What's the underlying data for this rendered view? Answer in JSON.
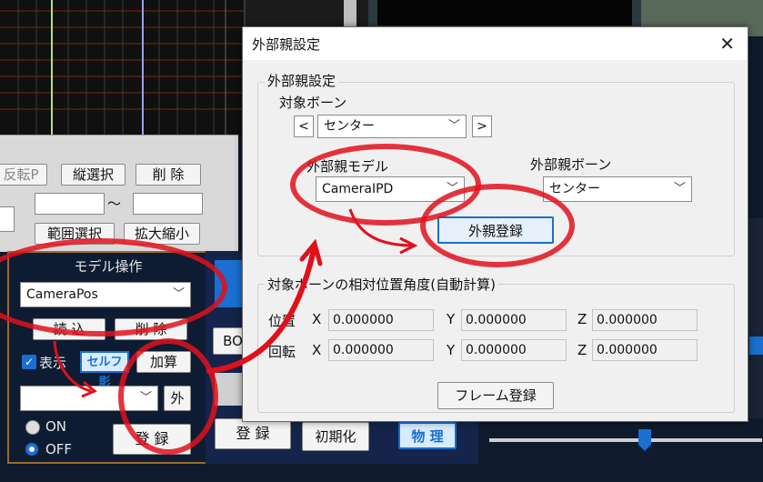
{
  "background": {
    "gray_panel": {
      "flip_label": "反転P",
      "vertical_select": "縦選択",
      "delete": "削 除",
      "tilde": "〜",
      "range_select": "範囲選択",
      "scale": "拡大縮小"
    },
    "model_panel": {
      "title": "モデル操作",
      "model_select": "CameraPos",
      "load": "読 込",
      "delete": "削 除",
      "display_label": "表示",
      "self_shadow": "セルフ影",
      "add_calc": "加算",
      "outer_button": "外",
      "on_label": "ON",
      "off_label": "OFF",
      "register": "登 録"
    },
    "middle_panel": {
      "bo_label": "BO",
      "register": "登 録",
      "initialize": "初期化",
      "physics": "物 理"
    }
  },
  "dialog": {
    "window_title": "外部親設定",
    "close_glyph": "✕",
    "section_title": "外部親設定",
    "target_bone_label": "対象ボーン",
    "prev_glyph": "<",
    "next_glyph": ">",
    "target_bone_value": "センター",
    "ext_parent_model_label": "外部親モデル",
    "ext_parent_model_value": "CameraIPD",
    "ext_parent_bone_label": "外部親ボーン",
    "ext_parent_bone_value": "センター",
    "register_button": "外親登録",
    "relative_section_title": "対象ボーンの相対位置角度(自動計算)",
    "position_label": "位置",
    "rotation_label": "回転",
    "x_label": "X",
    "y_label": "Y",
    "z_label": "Z",
    "position": {
      "x": "0.000000",
      "y": "0.000000",
      "z": "0.000000"
    },
    "rotation": {
      "x": "0.000000",
      "y": "0.000000",
      "z": "0.000000"
    },
    "frame_register_button": "フレーム登録"
  },
  "colors": {
    "annotation_red": "#e0101c",
    "accent_blue": "#1a6fd0"
  }
}
